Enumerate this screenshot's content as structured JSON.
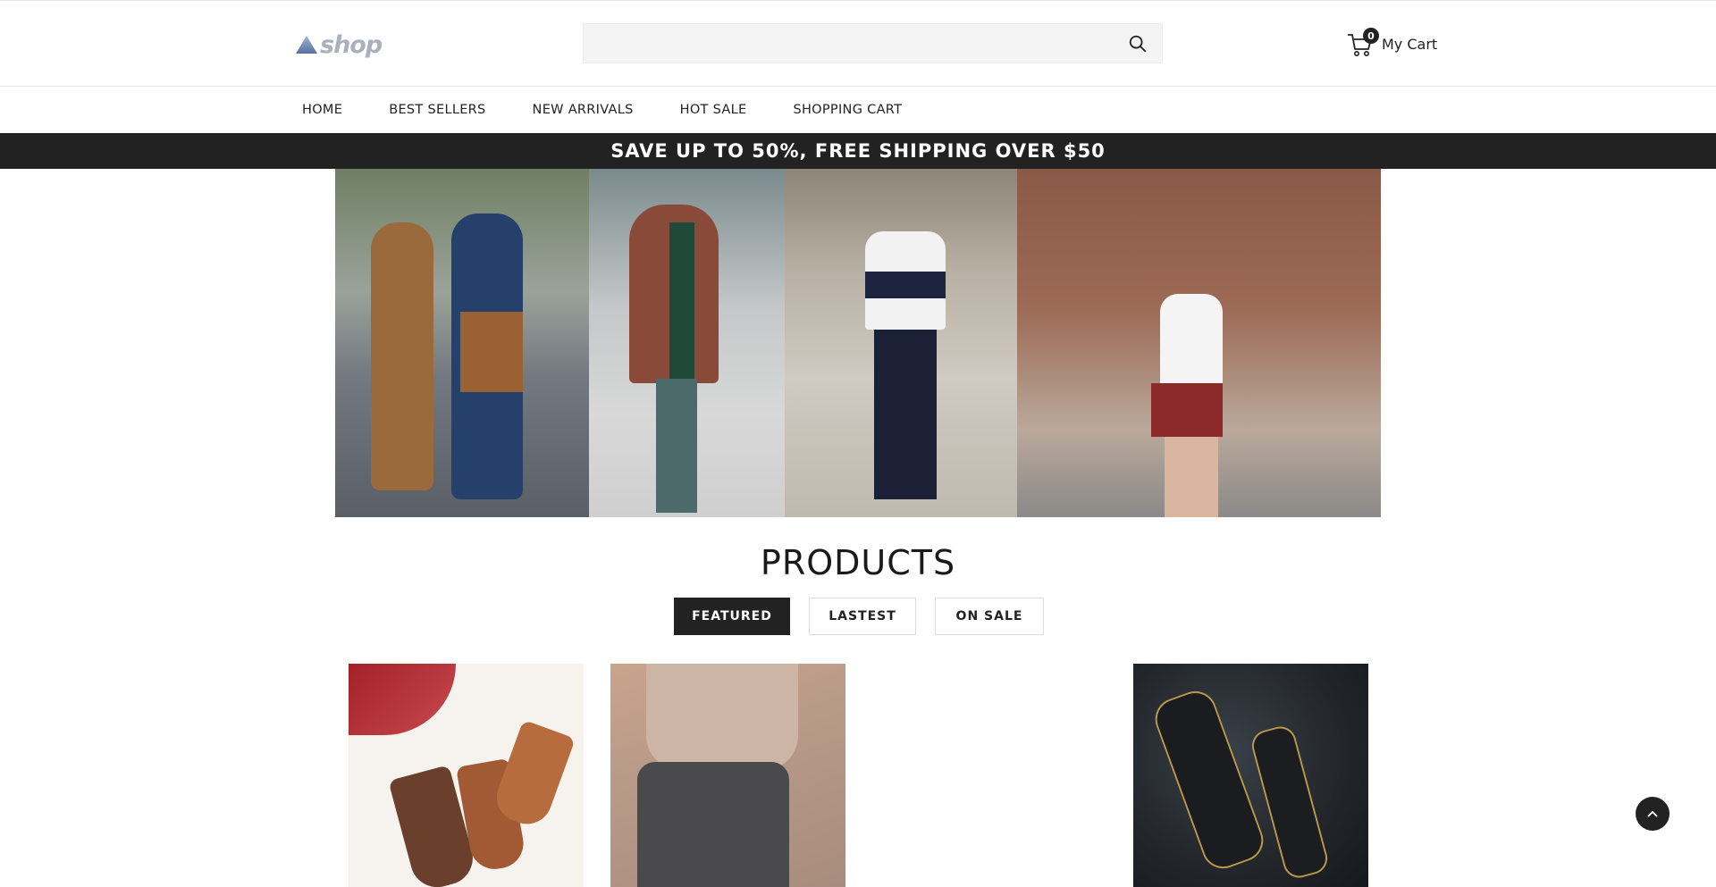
{
  "header": {
    "logo_text": "shop",
    "search": {
      "placeholder": "",
      "value": ""
    },
    "cart": {
      "count": "0",
      "label": "My Cart"
    }
  },
  "nav": {
    "items": [
      "HOME",
      "BEST SELLERS",
      "NEW ARRIVALS",
      "HOT SALE",
      "SHOPPING CART"
    ]
  },
  "promo": {
    "text": "SAVE UP TO 50%, FREE SHIPPING OVER $50"
  },
  "products": {
    "title": "PRODUCTS",
    "tabs": [
      {
        "label": "FEATURED",
        "active": true
      },
      {
        "label": "LASTEST",
        "active": false
      },
      {
        "label": "ON SALE",
        "active": false
      }
    ]
  },
  "colors": {
    "dark": "#222222",
    "logo": "#aab0bd",
    "search_bg": "#f4f4f4"
  },
  "icons": [
    "logo-triangle-icon",
    "search-icon",
    "cart-icon",
    "chevron-up-icon"
  ]
}
